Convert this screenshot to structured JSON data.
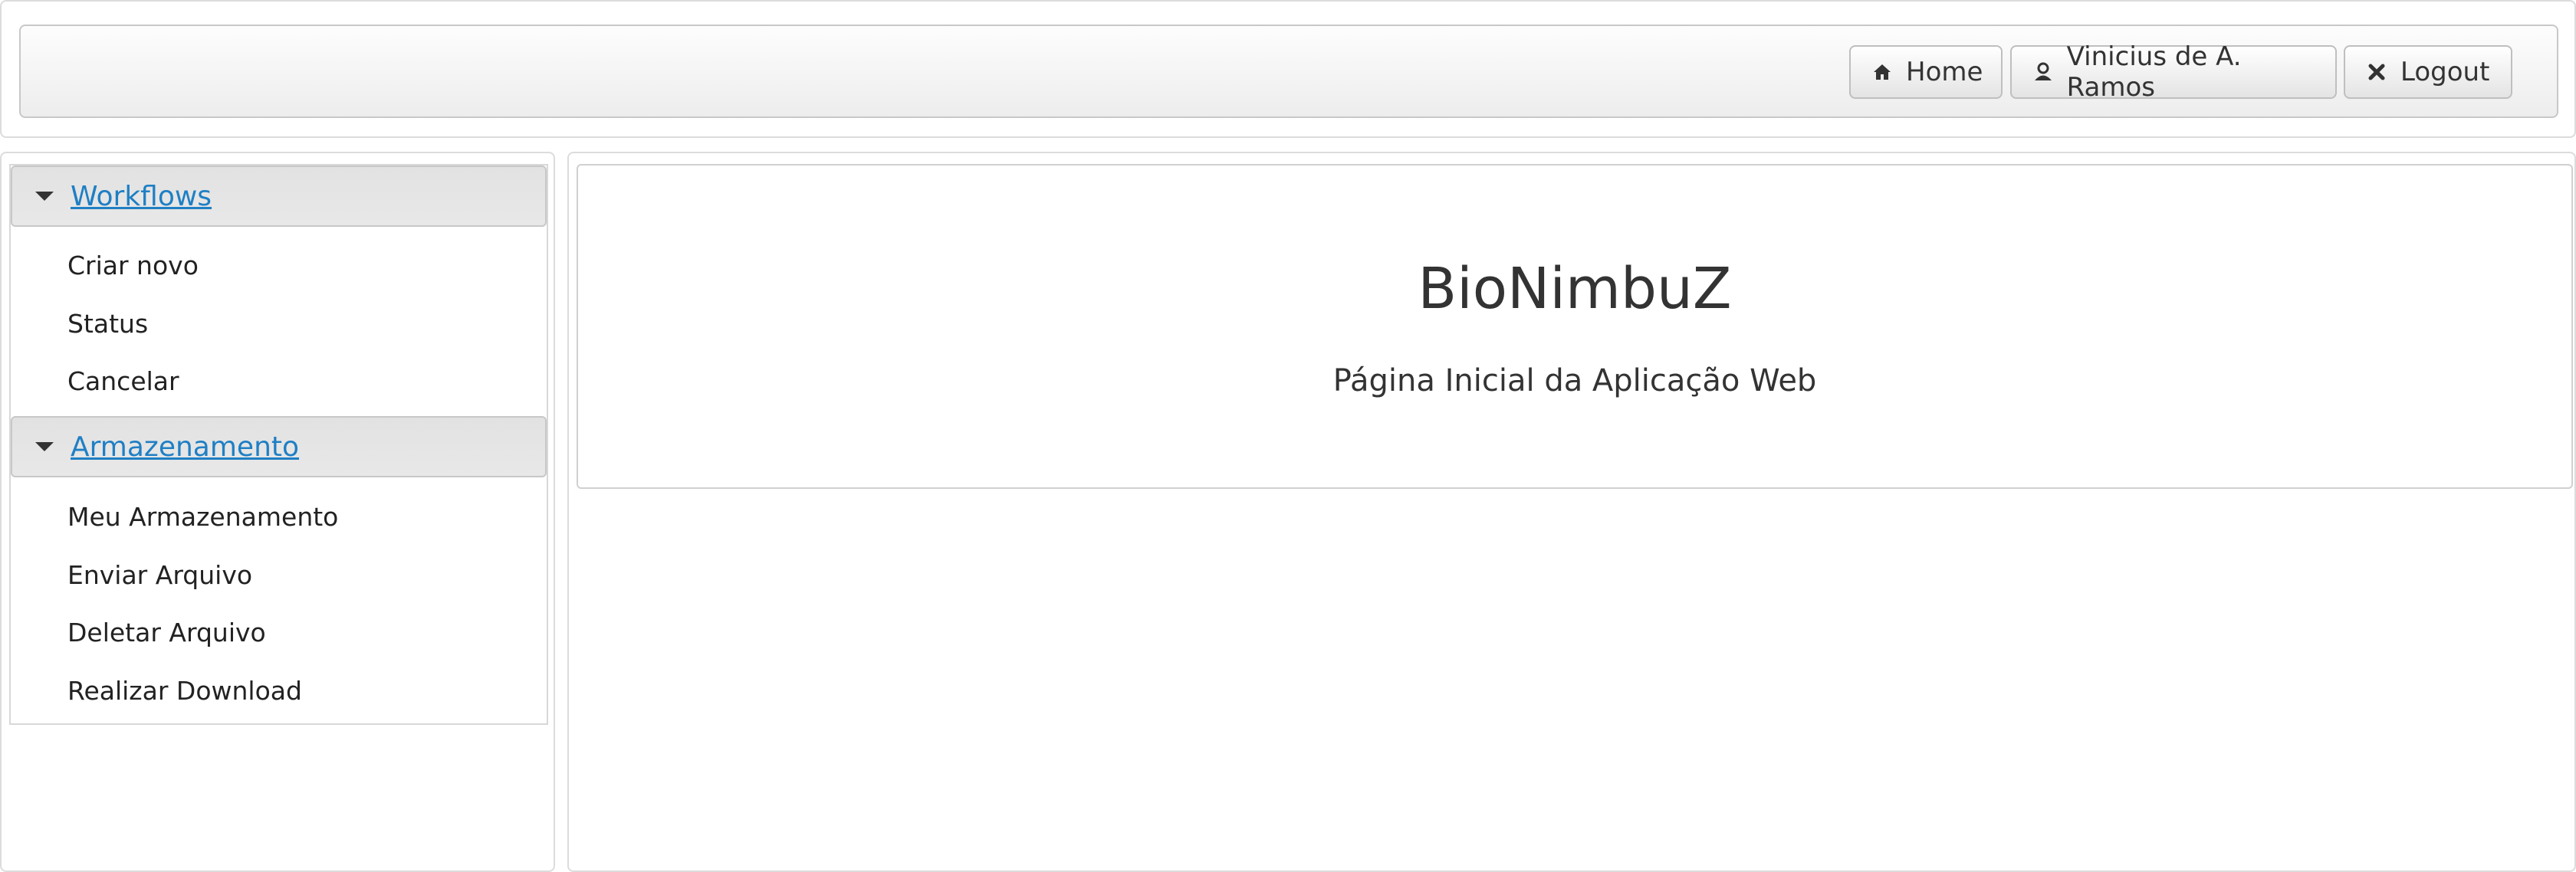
{
  "header": {
    "home_label": "Home",
    "user_label": "Vinicius de A. Ramos",
    "logout_label": "Logout",
    "icons": {
      "home": "home-icon",
      "user": "user-icon",
      "logout": "close-icon"
    }
  },
  "sidebar": {
    "sections": [
      {
        "title": "Workflows",
        "items": [
          "Criar novo",
          "Status",
          "Cancelar"
        ]
      },
      {
        "title": "Armazenamento",
        "items": [
          "Meu Armazenamento",
          "Enviar Arquivo",
          "Deletar Arquivo",
          "Realizar Download"
        ]
      }
    ]
  },
  "main": {
    "title": "BioNimbuZ",
    "subtitle": "Página Inicial da Aplicação Web"
  },
  "colors": {
    "link": "#1f7fc4",
    "text": "#333333",
    "border": "#dcdcdc"
  }
}
